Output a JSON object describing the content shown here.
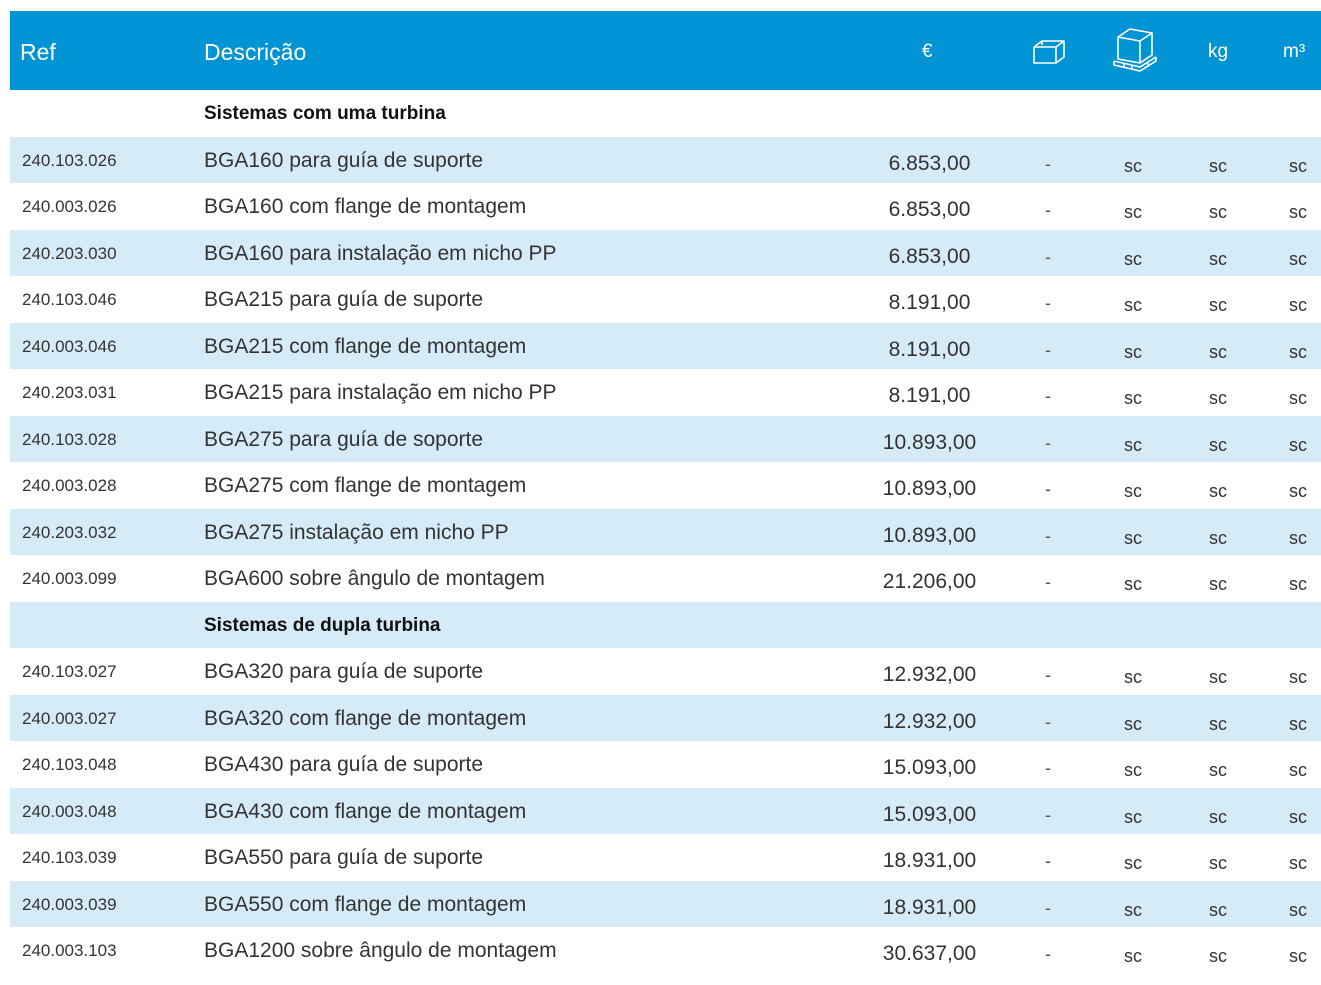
{
  "header": {
    "ref": "Ref",
    "desc": "Descrição",
    "price": "€",
    "box_icon": "box-icon",
    "pallet_icon": "pallet-icon",
    "kg": "kg",
    "m3": "m³"
  },
  "rows": [
    {
      "section": "Sistemas com uma turbina"
    },
    {
      "ref": "240.103.026",
      "desc": "BGA160 para guía de suporte",
      "price": "6.853,00",
      "box": "-",
      "pallet": "sc",
      "kg": "sc",
      "m3": "sc"
    },
    {
      "ref": "240.003.026",
      "desc": "BGA160 com flange  de montagem",
      "price": "6.853,00",
      "box": "-",
      "pallet": "sc",
      "kg": "sc",
      "m3": "sc"
    },
    {
      "ref": "240.203.030",
      "desc": "BGA160 para instalação em nicho PP",
      "price": "6.853,00",
      "box": "-",
      "pallet": "sc",
      "kg": "sc",
      "m3": "sc"
    },
    {
      "ref": "240.103.046",
      "desc": "BGA215 para guía de suporte",
      "price": "8.191,00",
      "box": "-",
      "pallet": "sc",
      "kg": "sc",
      "m3": "sc"
    },
    {
      "ref": "240.003.046",
      "desc": "BGA215 com flange  de montagem",
      "price": "8.191,00",
      "box": "-",
      "pallet": "sc",
      "kg": "sc",
      "m3": "sc"
    },
    {
      "ref": "240.203.031",
      "desc": "BGA215 para instalação em nicho PP",
      "price": "8.191,00",
      "box": "-",
      "pallet": "sc",
      "kg": "sc",
      "m3": "sc"
    },
    {
      "ref": "240.103.028",
      "desc": "BGA275 para guía de soporte",
      "price": "10.893,00",
      "box": "-",
      "pallet": "sc",
      "kg": "sc",
      "m3": "sc"
    },
    {
      "ref": "240.003.028",
      "desc": "BGA275 com flange  de montagem",
      "price": "10.893,00",
      "box": "-",
      "pallet": "sc",
      "kg": "sc",
      "m3": "sc"
    },
    {
      "ref": "240.203.032",
      "desc": "BGA275 instalação em nicho PP",
      "price": "10.893,00",
      "box": "-",
      "pallet": "sc",
      "kg": "sc",
      "m3": "sc"
    },
    {
      "ref": "240.003.099",
      "desc": "BGA600 sobre ângulo de montagem",
      "price": "21.206,00",
      "box": "-",
      "pallet": "sc",
      "kg": "sc",
      "m3": "sc"
    },
    {
      "section": "Sistemas de dupla turbina"
    },
    {
      "ref": "240.103.027",
      "desc": "BGA320 para guía de suporte",
      "price": "12.932,00",
      "box": "-",
      "pallet": "sc",
      "kg": "sc",
      "m3": "sc"
    },
    {
      "ref": "240.003.027",
      "desc": "BGA320 com flange  de montagem",
      "price": "12.932,00",
      "box": "-",
      "pallet": "sc",
      "kg": "sc",
      "m3": "sc"
    },
    {
      "ref": "240.103.048",
      "desc": "BGA430 para guía de suporte",
      "price": "15.093,00",
      "box": "-",
      "pallet": "sc",
      "kg": "sc",
      "m3": "sc"
    },
    {
      "ref": "240.003.048",
      "desc": "BGA430 com flange  de montagem",
      "price": "15.093,00",
      "box": "-",
      "pallet": "sc",
      "kg": "sc",
      "m3": "sc"
    },
    {
      "ref": "240.103.039",
      "desc": "BGA550 para guía de suporte",
      "price": "18.931,00",
      "box": "-",
      "pallet": "sc",
      "kg": "sc",
      "m3": "sc"
    },
    {
      "ref": "240.003.039",
      "desc": "BGA550 com flange  de montagem",
      "price": "18.931,00",
      "box": "-",
      "pallet": "sc",
      "kg": "sc",
      "m3": "sc"
    },
    {
      "ref": "240.003.103",
      "desc": "BGA1200 sobre ângulo de montagem",
      "price": "30.637,00",
      "box": "-",
      "pallet": "sc",
      "kg": "sc",
      "m3": "sc"
    }
  ],
  "colors": {
    "header_bg": "#0094d4",
    "alt_row_bg": "#d6ebf8"
  }
}
